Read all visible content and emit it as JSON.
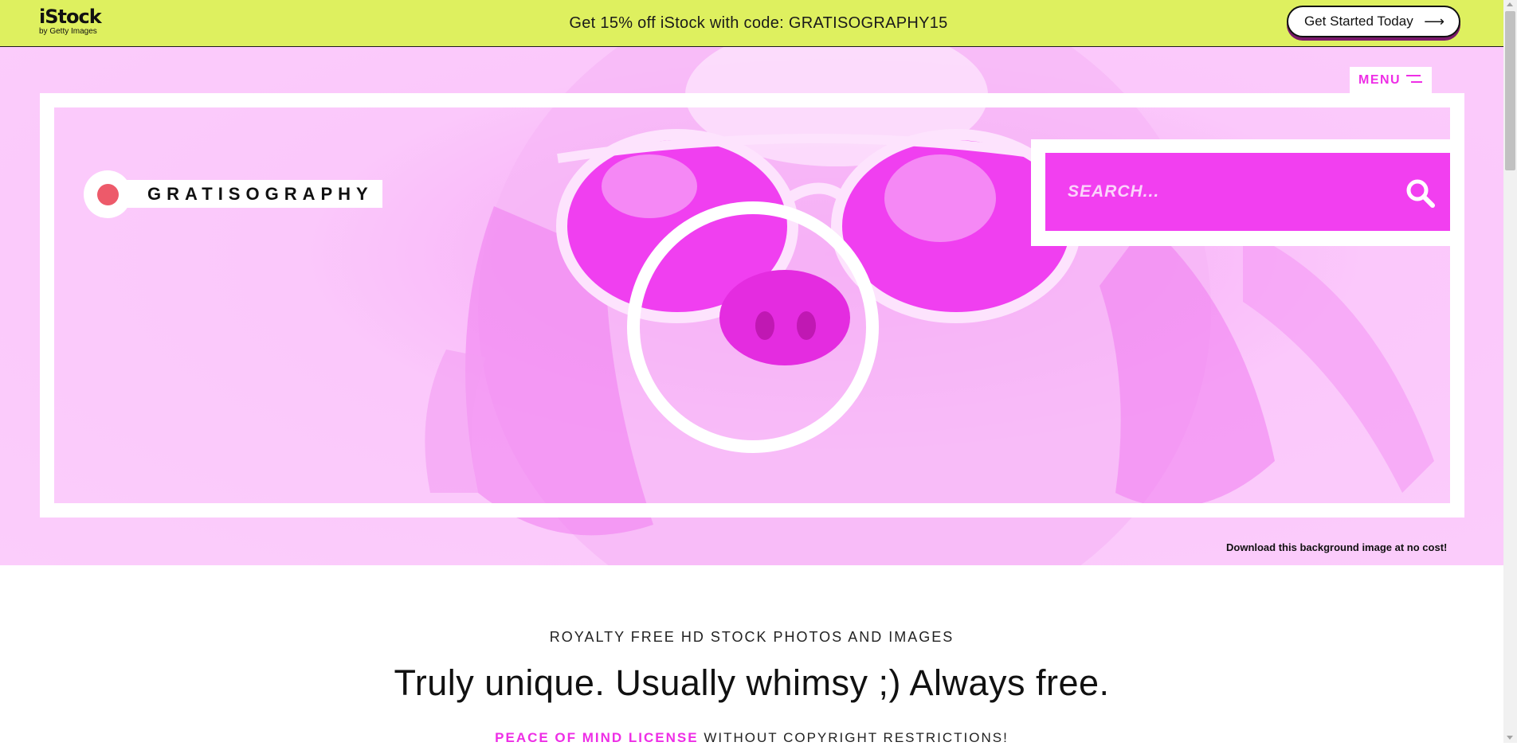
{
  "promo_bar": {
    "logo_text": "iStock",
    "logo_subtext": "by Getty Images",
    "message": "Get 15% off iStock with code: GRATISOGRAPHY15",
    "cta_label": "Get Started Today",
    "cta_icon": "arrow-right-icon",
    "background_color": "#def05f"
  },
  "hero": {
    "menu_label": "MENU",
    "menu_icon": "hamburger-icon",
    "logo_text": "GRATISOGRAPHY",
    "search_placeholder": "SEARCH...",
    "search_icon": "search-icon",
    "background_credit": "Download this background image at no cost!",
    "accent_color": "#ee2ee6",
    "logo_dot_color": "#ed5a6a"
  },
  "intro": {
    "eyebrow": "ROYALTY FREE HD STOCK PHOTOS AND IMAGES",
    "headline": "Truly unique. Usually whimsy ;) Always free.",
    "license_link": "PEACE OF MIND LICENSE",
    "license_rest": "WITHOUT COPYRIGHT RESTRICTIONS!"
  }
}
